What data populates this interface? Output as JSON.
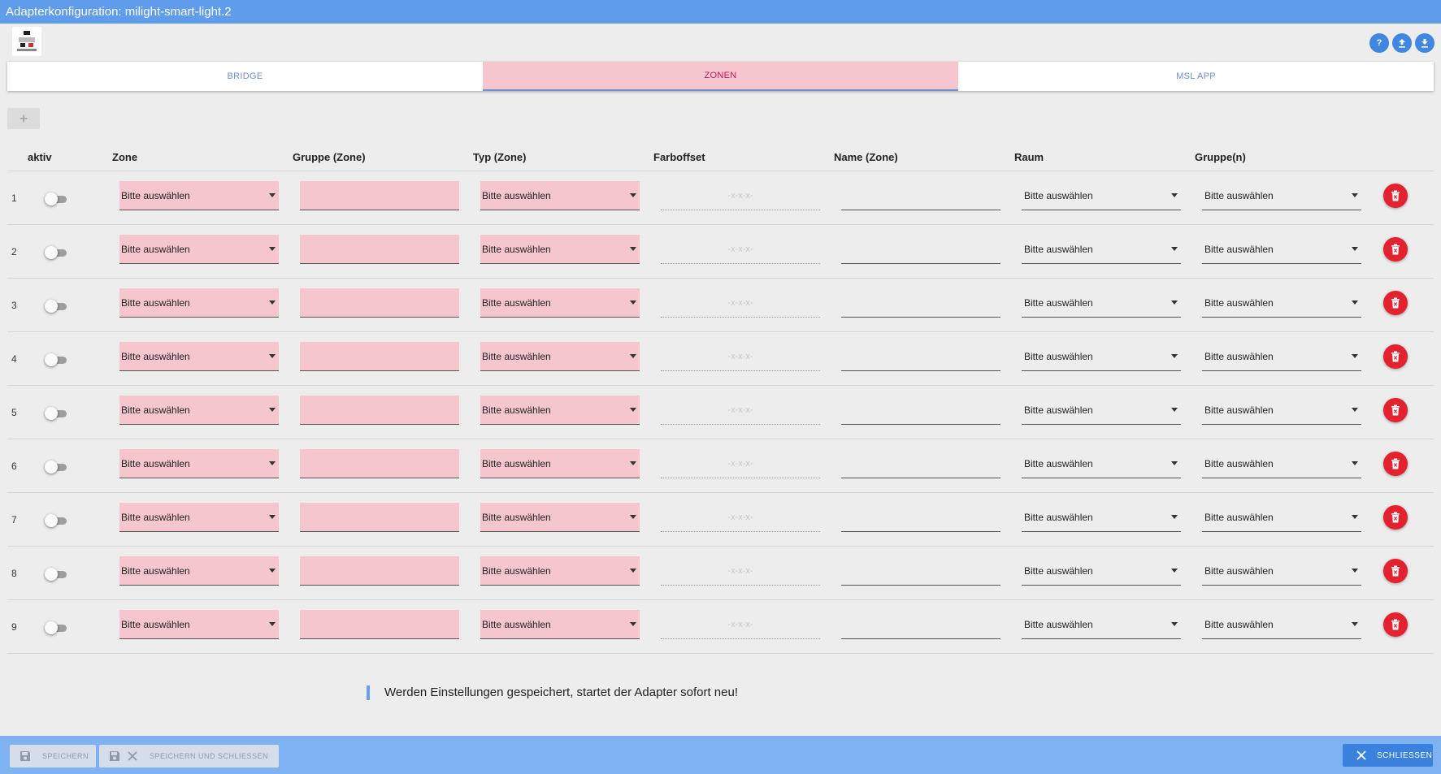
{
  "window": {
    "title": "Adapterkonfiguration: milight-smart-light.2"
  },
  "tabs": [
    {
      "label": "BRIDGE",
      "active": false
    },
    {
      "label": "ZONEN",
      "active": true
    },
    {
      "label": "MSL APP",
      "active": false
    }
  ],
  "top_buttons": [
    "help-icon",
    "upload-icon",
    "download-icon"
  ],
  "add_button": {
    "label": "+"
  },
  "table": {
    "headers": {
      "active": "aktiv",
      "zone": "Zone",
      "group_zone": "Gruppe (Zone)",
      "type_zone": "Typ (Zone)",
      "color_offset": "Farboffset",
      "name_zone": "Name (Zone)",
      "room": "Raum",
      "groups": "Gruppe(n)"
    },
    "rows": [
      {
        "num": "1",
        "zone": "Bitte auswählen",
        "type": "Bitte auswählen",
        "color_offset": "-x-x-x-",
        "room": "Bitte auswählen",
        "groups": "Bitte auswählen"
      },
      {
        "num": "2",
        "zone": "Bitte auswählen",
        "type": "Bitte auswählen",
        "color_offset": "-x-x-x-",
        "room": "Bitte auswählen",
        "groups": "Bitte auswählen"
      },
      {
        "num": "3",
        "zone": "Bitte auswählen",
        "type": "Bitte auswählen",
        "color_offset": "-x-x-x-",
        "room": "Bitte auswählen",
        "groups": "Bitte auswählen"
      },
      {
        "num": "4",
        "zone": "Bitte auswählen",
        "type": "Bitte auswählen",
        "color_offset": "-x-x-x-",
        "room": "Bitte auswählen",
        "groups": "Bitte auswählen"
      },
      {
        "num": "5",
        "zone": "Bitte auswählen",
        "type": "Bitte auswählen",
        "color_offset": "-x-x-x-",
        "room": "Bitte auswählen",
        "groups": "Bitte auswählen"
      },
      {
        "num": "6",
        "zone": "Bitte auswählen",
        "type": "Bitte auswählen",
        "color_offset": "-x-x-x-",
        "room": "Bitte auswählen",
        "groups": "Bitte auswählen"
      },
      {
        "num": "7",
        "zone": "Bitte auswählen",
        "type": "Bitte auswählen",
        "color_offset": "-x-x-x-",
        "room": "Bitte auswählen",
        "groups": "Bitte auswählen"
      },
      {
        "num": "8",
        "zone": "Bitte auswählen",
        "type": "Bitte auswählen",
        "color_offset": "-x-x-x-",
        "room": "Bitte auswählen",
        "groups": "Bitte auswählen"
      },
      {
        "num": "9",
        "zone": "Bitte auswählen",
        "type": "Bitte auswählen",
        "color_offset": "-x-x-x-",
        "room": "Bitte auswählen",
        "groups": "Bitte auswählen"
      }
    ]
  },
  "notice": "Werden Einstellungen gespeichert, startet der Adapter sofort neu!",
  "footer": {
    "save": "SPEICHERN",
    "save_close": "SPEICHERN UND SCHLIESSEN",
    "close": "SCHLIESSEN"
  },
  "colors": {
    "titlebar": "#5f9cec",
    "pink_field": "#f6c6cf",
    "delete": "#e3212f",
    "footer": "#7fb2f2",
    "close_button": "#3a82dd"
  }
}
